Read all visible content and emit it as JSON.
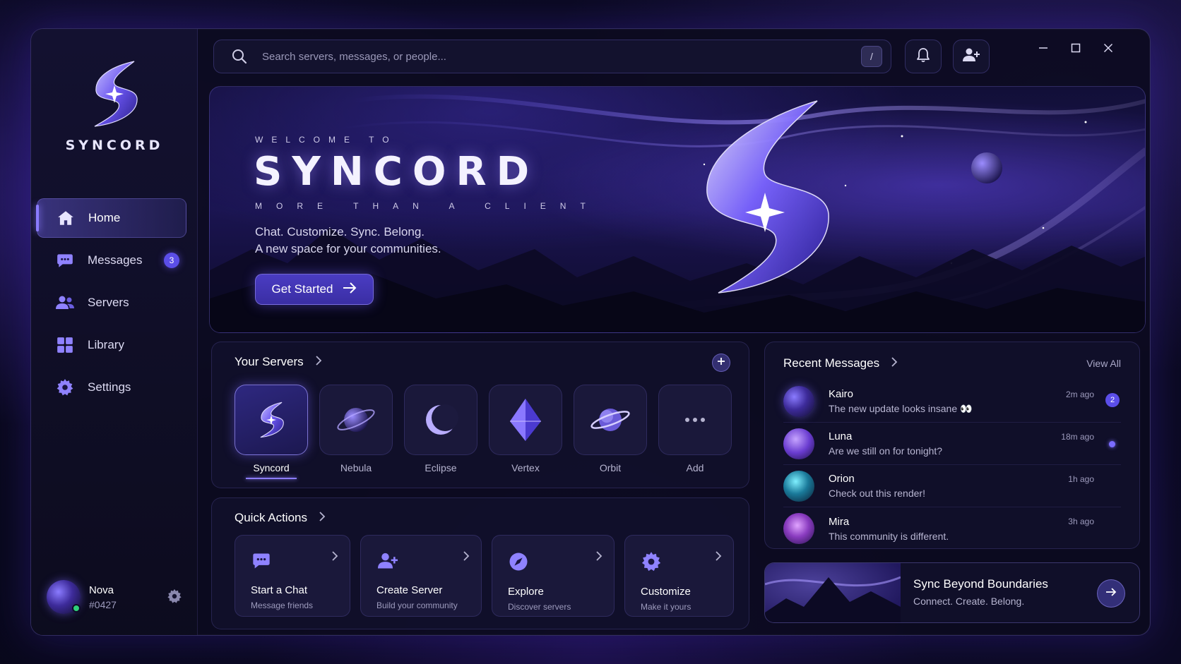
{
  "app": {
    "name": "SYNCORD"
  },
  "sidebar": {
    "items": [
      {
        "label": "Home",
        "icon": "home-icon",
        "active": true
      },
      {
        "label": "Messages",
        "icon": "chat-icon",
        "badge": "3"
      },
      {
        "label": "Servers",
        "icon": "users-icon"
      },
      {
        "label": "Library",
        "icon": "grid-icon"
      },
      {
        "label": "Settings",
        "icon": "gear-icon"
      }
    ],
    "user": {
      "name": "Nova",
      "tag": "#0427",
      "status": "online"
    }
  },
  "search": {
    "placeholder": "Search servers, messages, or people...",
    "shortcut": "/"
  },
  "hero": {
    "welcome": "WELCOME TO",
    "title": "SYNCORD",
    "subtitle": "MORE THAN A CLIENT",
    "line1": "Chat. Customize. Sync. Belong.",
    "line2": "A new space for your communities.",
    "cta": "Get Started"
  },
  "servers": {
    "title": "Your Servers",
    "items": [
      {
        "name": "Syncord",
        "active": true
      },
      {
        "name": "Nebula"
      },
      {
        "name": "Eclipse"
      },
      {
        "name": "Vertex"
      },
      {
        "name": "Orbit"
      },
      {
        "name": "Add"
      }
    ]
  },
  "quick_actions": {
    "title": "Quick Actions",
    "items": [
      {
        "title": "Start a Chat",
        "desc": "Message friends",
        "icon": "chat-icon"
      },
      {
        "title": "Create Server",
        "desc": "Build your community",
        "icon": "add-user-icon"
      },
      {
        "title": "Explore",
        "desc": "Discover servers",
        "icon": "compass-icon"
      },
      {
        "title": "Customize",
        "desc": "Make it yours",
        "icon": "gear-icon"
      }
    ]
  },
  "recent_messages": {
    "title": "Recent Messages",
    "view_all": "View All",
    "items": [
      {
        "name": "Kairo",
        "text": "The new update looks insane 👀",
        "time": "2m ago",
        "badge": "2"
      },
      {
        "name": "Luna",
        "text": "Are we still on for tonight?",
        "time": "18m ago",
        "unread": true
      },
      {
        "name": "Orion",
        "text": "Check out this render!",
        "time": "1h ago"
      },
      {
        "name": "Mira",
        "text": "This community is different.",
        "time": "3h ago"
      }
    ]
  },
  "promo": {
    "title": "Sync Beyond Boundaries",
    "subtitle": "Connect. Create. Belong."
  },
  "colors": {
    "accent": "#5b4ee8",
    "glow": "#8b7cff",
    "online": "#2fd07a"
  }
}
